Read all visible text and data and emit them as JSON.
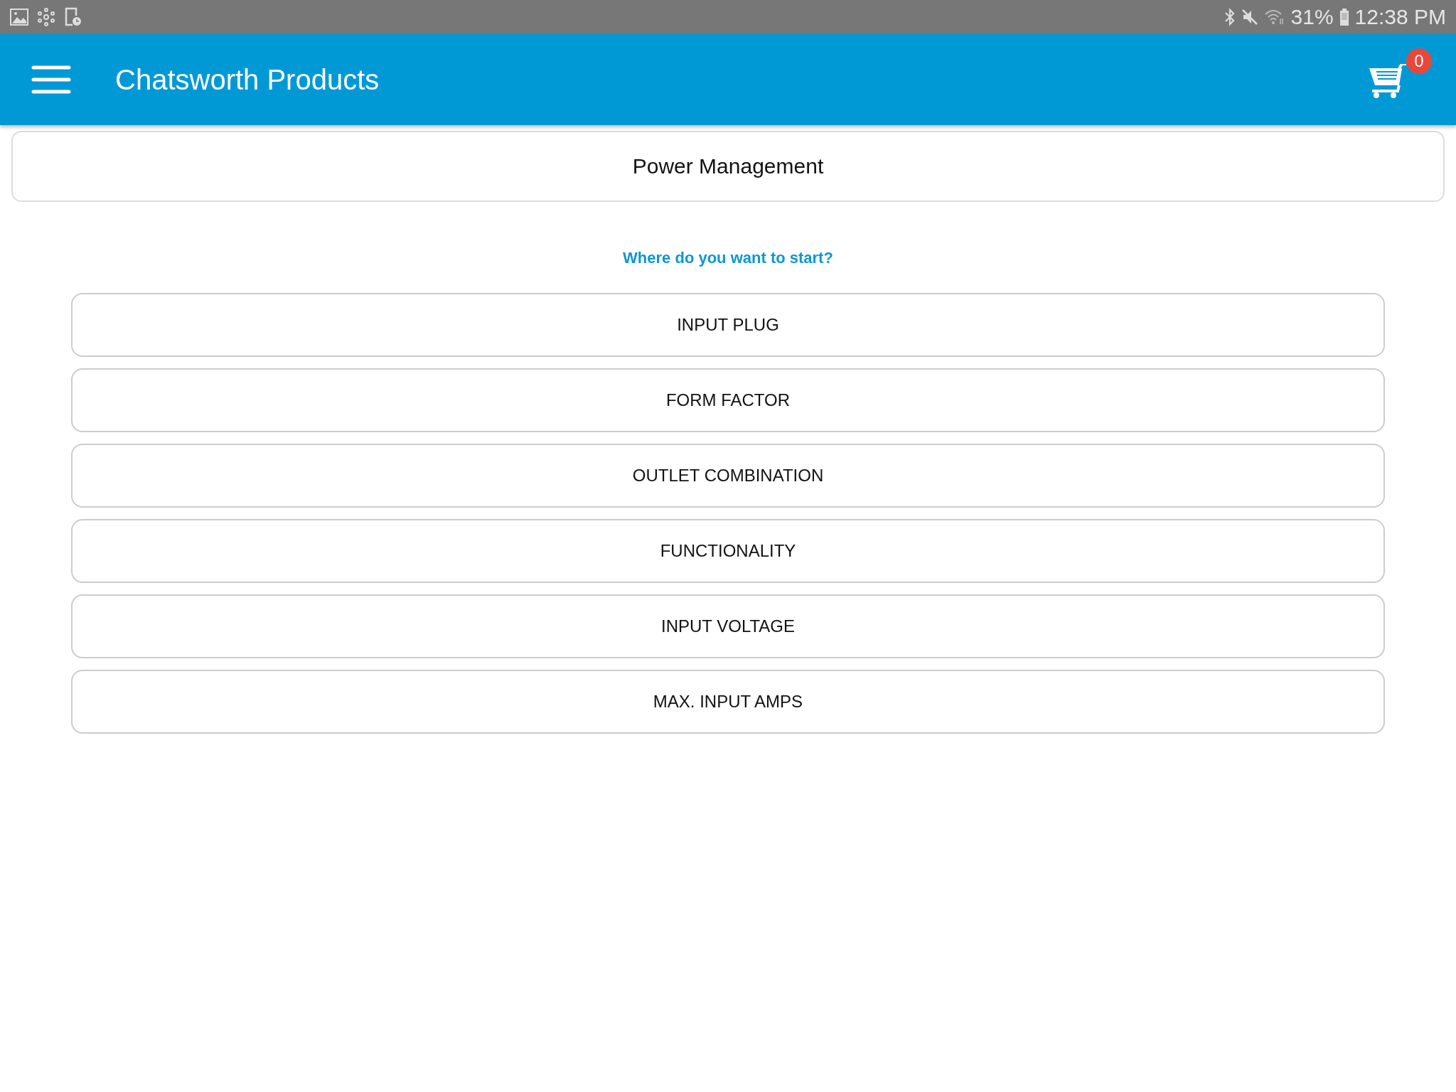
{
  "status_bar": {
    "battery_percent": "31%",
    "time": "12:38 PM"
  },
  "app_bar": {
    "title": "Chatsworth Products",
    "cart_count": "0"
  },
  "page_title": "Power Management",
  "prompt": "Where do you want to start?",
  "options": [
    "INPUT PLUG",
    "FORM FACTOR",
    "OUTLET COMBINATION",
    "FUNCTIONALITY",
    "INPUT VOLTAGE",
    "MAX. INPUT AMPS"
  ]
}
